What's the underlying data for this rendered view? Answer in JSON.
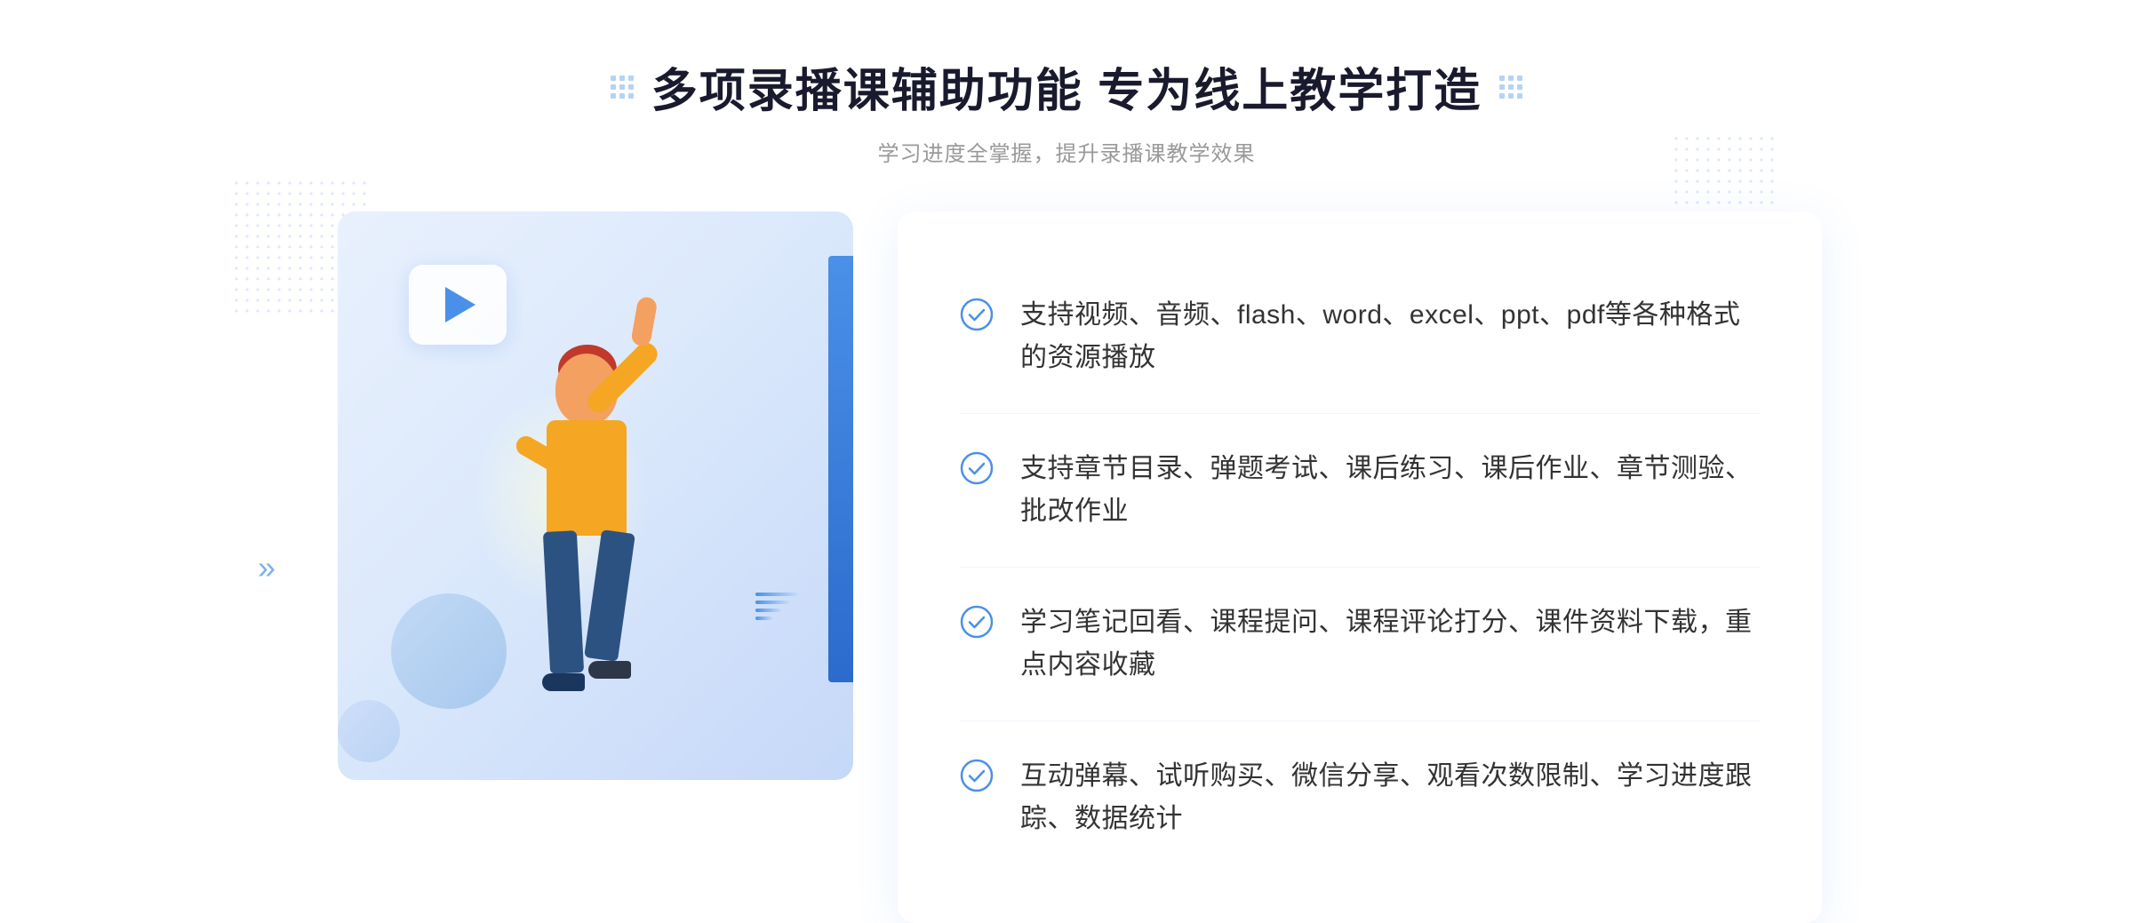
{
  "header": {
    "title": "多项录播课辅助功能 专为线上教学打造",
    "subtitle": "学习进度全掌握，提升录播课教学效果"
  },
  "features": [
    {
      "id": 1,
      "text": "支持视频、音频、flash、word、excel、ppt、pdf等各种格式的资源播放"
    },
    {
      "id": 2,
      "text": "支持章节目录、弹题考试、课后练习、课后作业、章节测验、批改作业"
    },
    {
      "id": 3,
      "text": "学习笔记回看、课程提问、课程评论打分、课件资料下载，重点内容收藏"
    },
    {
      "id": 4,
      "text": "互动弹幕、试听购买、微信分享、观看次数限制、学习进度跟踪、数据统计"
    }
  ],
  "icons": {
    "check": "check-circle-icon",
    "play": "play-icon",
    "grid_left": "grid-dots-left-icon",
    "grid_right": "grid-dots-right-icon"
  },
  "colors": {
    "primary": "#4a90e8",
    "title": "#1a1a2e",
    "subtitle": "#999999",
    "text": "#333333",
    "border": "#f0f4fc"
  }
}
